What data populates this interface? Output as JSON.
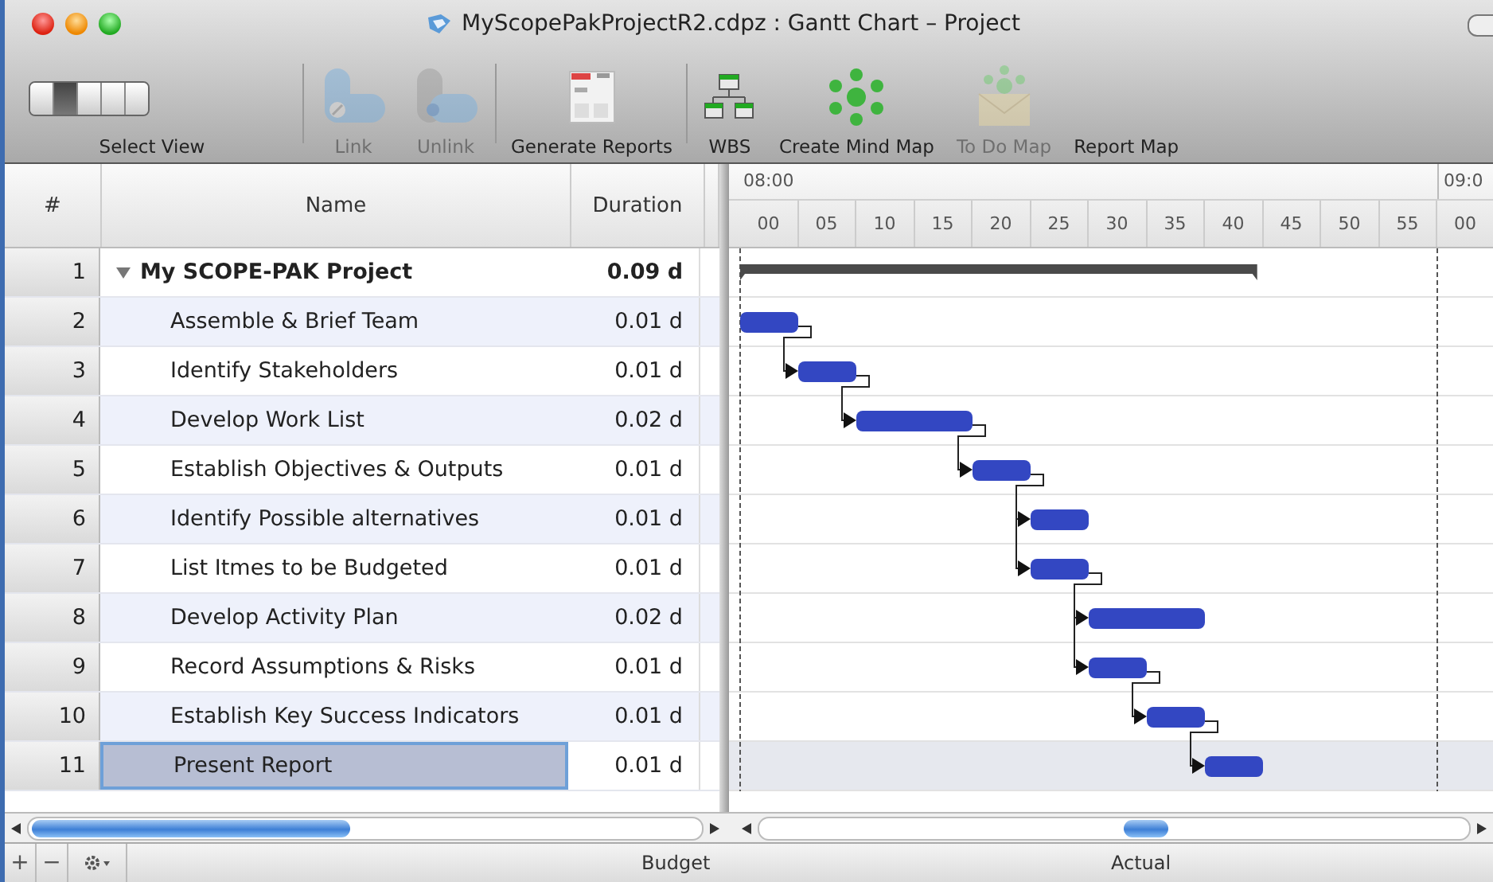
{
  "window": {
    "title": "MyScopePakProjectR2.cdpz : Gantt Chart – Project"
  },
  "toolbar": {
    "select_view": {
      "label": "Select View",
      "segments": [
        {
          "selected": false
        },
        {
          "selected": true
        },
        {
          "selected": false
        },
        {
          "selected": false
        },
        {
          "selected": false
        }
      ]
    },
    "buttons": [
      {
        "kind": "link",
        "label": "Link",
        "disabled": true,
        "separator_before": true
      },
      {
        "kind": "unlink",
        "label": "Unlink",
        "disabled": true,
        "separator_before": false
      },
      {
        "kind": "reports",
        "label": "Generate Reports",
        "disabled": false,
        "separator_before": true
      },
      {
        "kind": "wbs",
        "label": "WBS",
        "disabled": false,
        "separator_before": true
      },
      {
        "kind": "mindmap",
        "label": "Create Mind Map",
        "disabled": false,
        "separator_before": false
      },
      {
        "kind": "todo",
        "label": "To Do Map",
        "disabled": true,
        "separator_before": false
      },
      {
        "kind": "reportmap",
        "label": "Report Map",
        "disabled": false,
        "separator_before": false
      }
    ]
  },
  "table": {
    "columns": [
      "#",
      "Name",
      "Duration"
    ],
    "rows": [
      {
        "number": "1",
        "name": "My SCOPE-PAK Project",
        "duration": "0.09 d",
        "expanded": true,
        "selected": false,
        "children": [
          {
            "number": "2",
            "name": "Assemble & Brief Team",
            "duration": "0.01 d",
            "selected": false
          },
          {
            "number": "3",
            "name": "Identify Stakeholders",
            "duration": "0.01 d",
            "selected": false
          },
          {
            "number": "4",
            "name": "Develop Work List",
            "duration": "0.02 d",
            "selected": false
          },
          {
            "number": "5",
            "name": "Establish Objectives & Outputs",
            "duration": "0.01 d",
            "selected": false
          },
          {
            "number": "6",
            "name": "Identify Possible alternatives",
            "duration": "0.01 d",
            "selected": false
          },
          {
            "number": "7",
            "name": "List Itmes to be Budgeted",
            "duration": "0.01 d",
            "selected": false
          },
          {
            "number": "8",
            "name": "Develop Activity Plan",
            "duration": "0.02 d",
            "selected": false
          },
          {
            "number": "9",
            "name": "Record Assumptions & Risks",
            "duration": "0.01 d",
            "selected": false
          },
          {
            "number": "10",
            "name": "Establish Key Success Indicators",
            "duration": "0.01 d",
            "selected": false
          },
          {
            "number": "11",
            "name": "Present Report",
            "duration": "0.01 d",
            "selected": true
          }
        ]
      }
    ]
  },
  "gantt": {
    "hour_labels": [
      "08:00",
      "09:0"
    ],
    "minute_labels": [
      "00",
      "05",
      "10",
      "15",
      "20",
      "25",
      "30",
      "35",
      "40",
      "45",
      "50",
      "55",
      "00"
    ]
  },
  "footer": {
    "buttons": [
      "+",
      "−"
    ],
    "budget_label": "Budget",
    "actual_label": "Actual"
  }
}
